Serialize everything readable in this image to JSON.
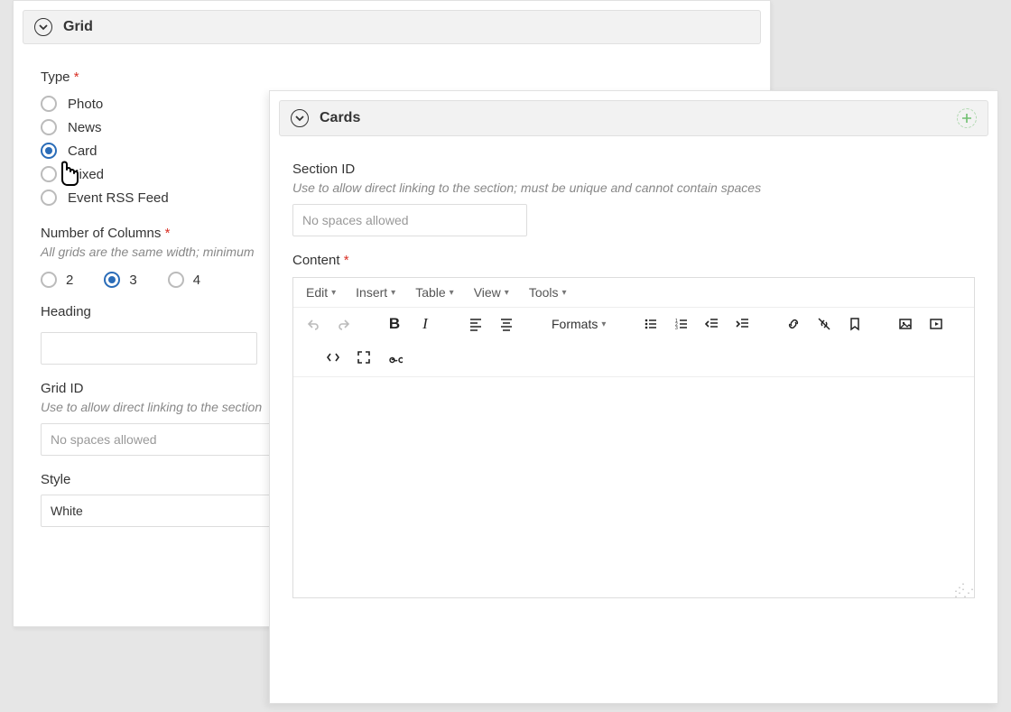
{
  "grid": {
    "title": "Grid",
    "type_label": "Type",
    "type_options": [
      "Photo",
      "News",
      "Card",
      "Mixed",
      "Event RSS Feed"
    ],
    "type_selected": "Card",
    "cols_label": "Number of Columns",
    "cols_hint": "All grids are the same width; minimum",
    "cols_options": [
      "2",
      "3",
      "4"
    ],
    "cols_selected": "3",
    "heading_label": "Heading",
    "gridid_label": "Grid ID",
    "gridid_hint": "Use to allow direct linking to the section",
    "gridid_placeholder": "No spaces allowed",
    "style_label": "Style",
    "style_value": "White"
  },
  "cards": {
    "title": "Cards",
    "sectionid_label": "Section ID",
    "sectionid_hint": "Use to allow direct linking to the section; must be unique and cannot contain spaces",
    "sectionid_placeholder": "No spaces allowed",
    "content_label": "Content"
  },
  "editor": {
    "menubar": [
      "Edit",
      "Insert",
      "Table",
      "View",
      "Tools"
    ],
    "formats_label": "Formats"
  }
}
